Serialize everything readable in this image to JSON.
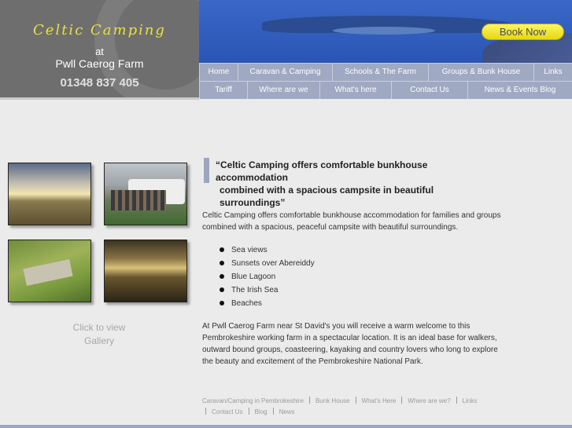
{
  "logo": {
    "title": "Celtic Camping",
    "at": "at",
    "farm": "Pwll Caerog Farm",
    "phone": "01348 837 405"
  },
  "banner": {
    "book_now": "Book Now"
  },
  "nav_row_1": [
    {
      "label": "Home"
    },
    {
      "label": "Caravan & Camping"
    },
    {
      "label": "Schools & The Farm"
    },
    {
      "label": "Groups & Bunk House"
    },
    {
      "label": "Links"
    }
  ],
  "nav_row_2": [
    {
      "label": "Tariff"
    },
    {
      "label": "Where are we"
    },
    {
      "label": "What's here"
    },
    {
      "label": "Contact Us"
    },
    {
      "label": "News & Events Blog"
    }
  ],
  "gallery": {
    "link_line1": "Click to view",
    "link_line2": "Gallery"
  },
  "quote": {
    "line1": "“Celtic Camping offers comfortable bunkhouse accommodation",
    "line2": "combined with a spacious campsite in beautiful surroundings”"
  },
  "intro": "Celtic Camping offers comfortable bunkhouse accommodation for families and groups combined with a spacious, peaceful campsite with beautiful surroundings.",
  "features": [
    "Sea views",
    "Sunsets over Abereiddy",
    "Blue Lagoon",
    "The Irish Sea",
    "Beaches"
  ],
  "welcome": "At Pwll Caerog Farm near St David's you will receive a warm welcome to this Pembrokeshire working farm in a spectacular location. It is an ideal base for walkers, outward bound groups, coasteering, kayaking and country lovers who long to explore the beauty and excitement of the Pembrokeshire National Park.",
  "footer_links": [
    "Caravan/Camping in Pembrokeshire",
    "Bunk House",
    "What's Here",
    "Where are we?",
    "Links",
    "Contact Us",
    "Blog",
    "News"
  ],
  "colors": {
    "background": "#ebebeb",
    "nav": "#9fa9c2",
    "logo_bg": "#6e6e6e",
    "logo_title": "#e8e040",
    "book_now": "#f5ec2a",
    "banner_sky": "#3360c0"
  }
}
